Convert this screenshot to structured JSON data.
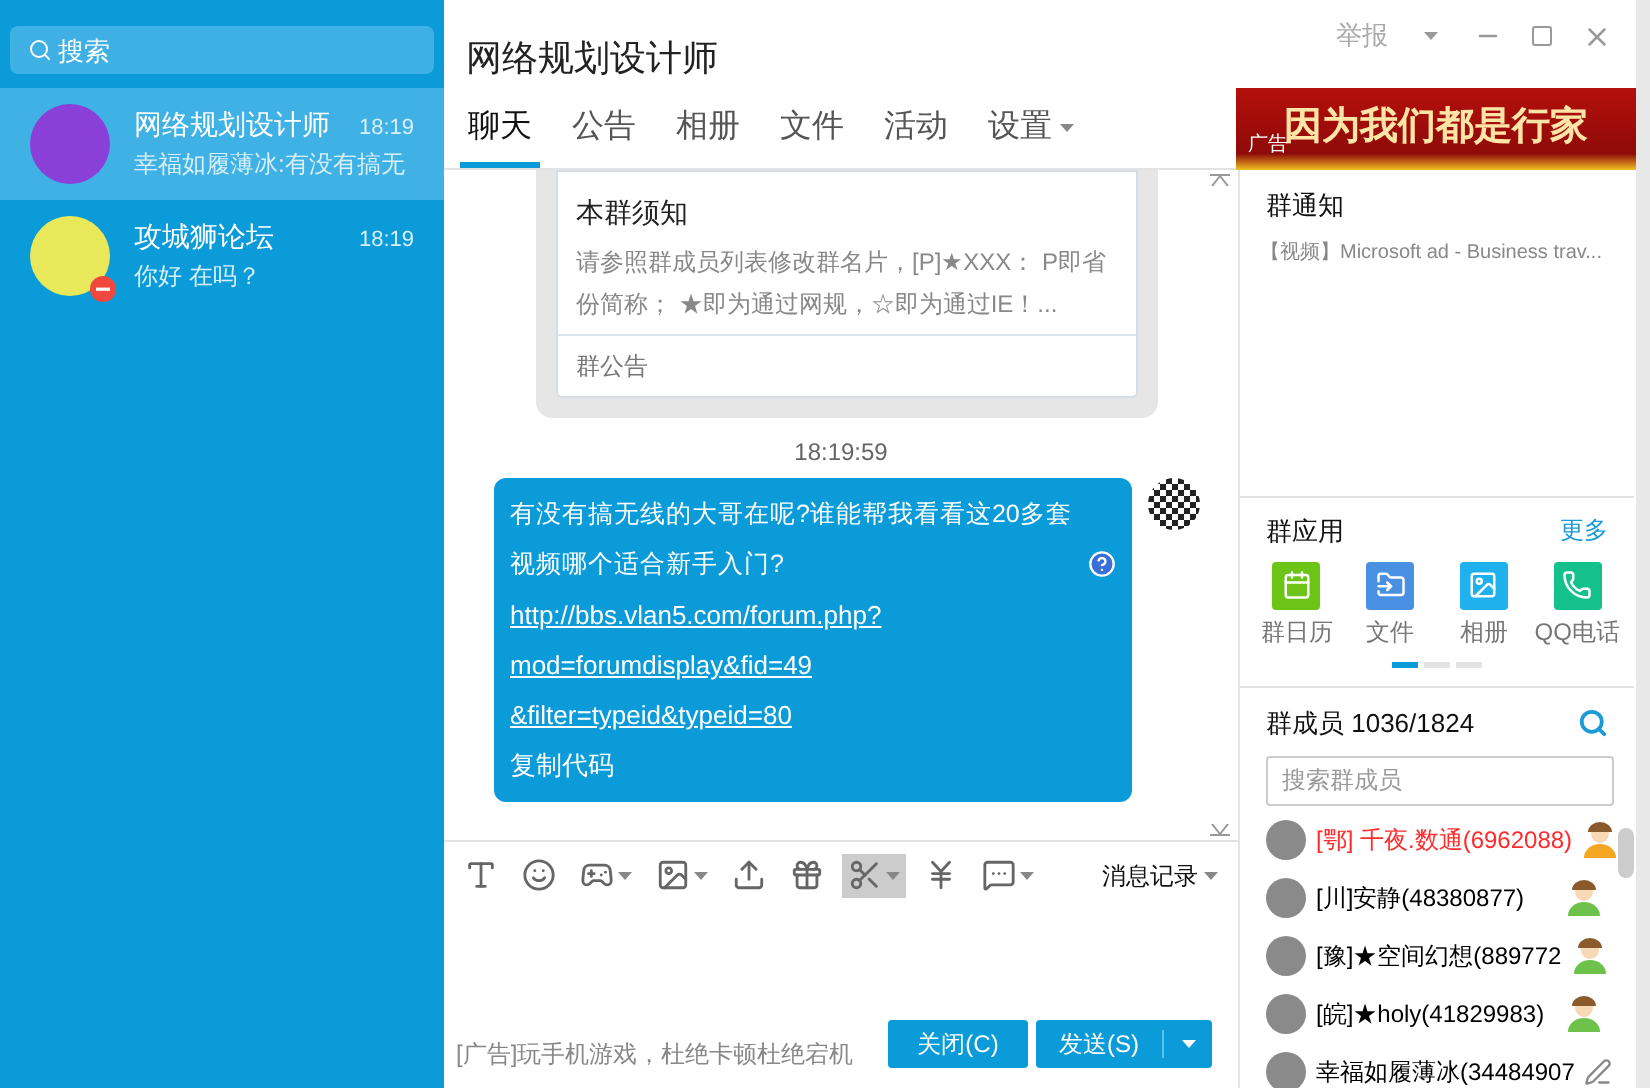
{
  "sidebar": {
    "search": {
      "placeholder": "搜索"
    },
    "chats": [
      {
        "name": "网络规划设计师",
        "time": "18:19",
        "preview": "幸福如履薄冰:有没有搞无",
        "selected": true,
        "muted_badge": false
      },
      {
        "name": "攻城狮论坛",
        "time": "18:19",
        "preview": "你好 在吗？",
        "selected": false,
        "muted_badge": true
      }
    ]
  },
  "window": {
    "title": "网络规划设计师",
    "report": "举报"
  },
  "tabs": [
    {
      "label": "聊天",
      "selected": true,
      "dropdown": false
    },
    {
      "label": "公告",
      "selected": false,
      "dropdown": false
    },
    {
      "label": "相册",
      "selected": false,
      "dropdown": false
    },
    {
      "label": "文件",
      "selected": false,
      "dropdown": false
    },
    {
      "label": "活动",
      "selected": false,
      "dropdown": false
    },
    {
      "label": "设置",
      "selected": false,
      "dropdown": true
    }
  ],
  "notice_card": {
    "title": "本群须知",
    "body": "请参照群成员列表修改群名片，[P]★XXX： P即省份简称； ★即为通过网规，☆即为通过IE！...",
    "footer": "群公告"
  },
  "timestamp": "18:19:59",
  "message": {
    "text": "有没有搞无线的大哥在呢?谁能帮我看看这20多套视频哪个适合新手入门?",
    "links": [
      "http://bbs.vlan5.com/forum.php?",
      "mod=forumdisplay&fid=49",
      "&filter=typeid&typeid=80"
    ],
    "action": "复制代码"
  },
  "toolbar": [
    {
      "kind": "font",
      "dropdown": false,
      "highlighted": false
    },
    {
      "kind": "emoji",
      "dropdown": false,
      "highlighted": false
    },
    {
      "kind": "game",
      "dropdown": true,
      "highlighted": false
    },
    {
      "kind": "image",
      "dropdown": true,
      "highlighted": false
    },
    {
      "kind": "upload",
      "dropdown": false,
      "highlighted": false
    },
    {
      "kind": "gift",
      "dropdown": false,
      "highlighted": false
    },
    {
      "kind": "scissors",
      "dropdown": true,
      "highlighted": true
    },
    {
      "kind": "payment",
      "dropdown": false,
      "highlighted": false
    },
    {
      "kind": "chat",
      "dropdown": true,
      "highlighted": false
    }
  ],
  "history": "消息记录",
  "bottom": {
    "ad": "[广告]玩手机游戏，杜绝卡顿杜绝宕机",
    "close": "关闭(C)",
    "send": "发送(S)"
  },
  "right": {
    "banner": {
      "text": "因为我们都是行家",
      "tag": "广告"
    },
    "notice": {
      "title": "群通知",
      "item": "【视频】Microsoft ad - Business trav..."
    },
    "apps": {
      "title": "群应用",
      "more": "更多",
      "items": [
        {
          "kind": "calendar",
          "label": "群日历",
          "color": "#6cc417"
        },
        {
          "kind": "file",
          "label": "文件",
          "color": "#4a90e2"
        },
        {
          "kind": "album",
          "label": "相册",
          "color": "#1fb1ee"
        },
        {
          "kind": "phone",
          "label": "QQ电话",
          "color": "#14c08c"
        }
      ],
      "pages": [
        {
          "selected": true
        },
        {
          "selected": false
        },
        {
          "selected": false
        }
      ]
    },
    "members": {
      "title": "群成员 1036/1824",
      "placeholder": "搜索群成员",
      "items": [
        {
          "name": "[鄂] 千夜.数通(6962088)",
          "color": "#ff2a2a",
          "kind": "owner"
        },
        {
          "name": "[川]安静(48380877)",
          "color": "#000000",
          "kind": "member"
        },
        {
          "name": "[豫]★空间幻想(889772",
          "color": "#000000",
          "kind": "member"
        },
        {
          "name": "[皖]★holy(41829983)",
          "color": "#000000",
          "kind": "member"
        },
        {
          "name": "幸福如履薄冰(34484907",
          "color": "#000000",
          "kind": "self"
        }
      ]
    }
  }
}
